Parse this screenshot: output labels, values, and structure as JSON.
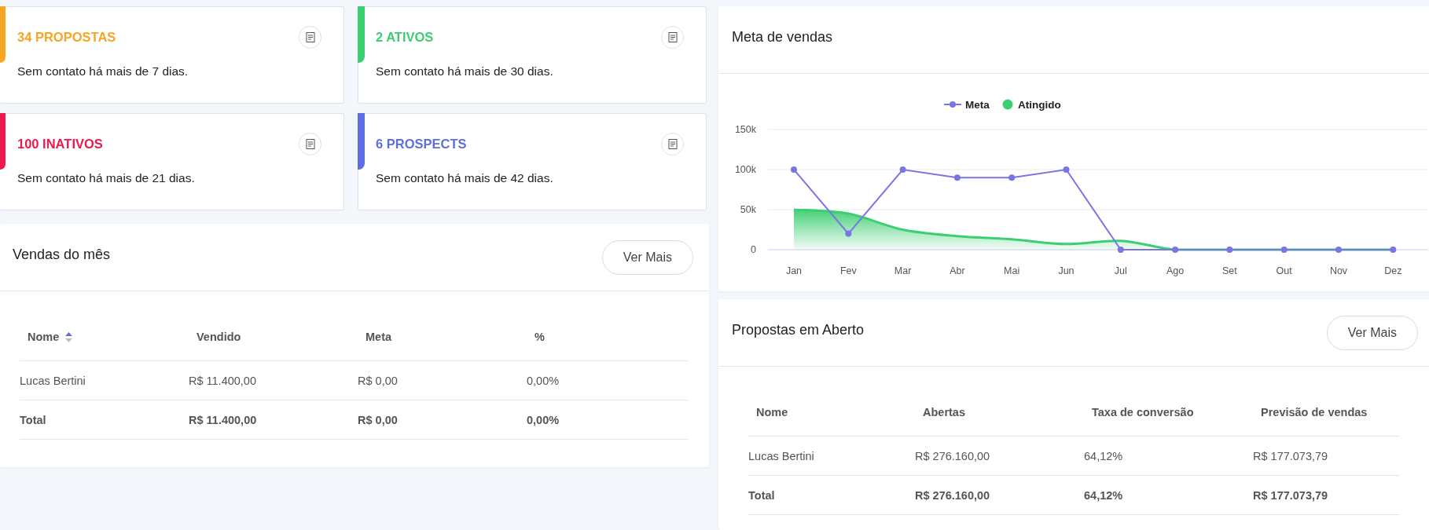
{
  "alert_cards": [
    {
      "title": "34 PROPOSTAS",
      "text": "Sem contato há mais de 7 dias.",
      "color": "#f6a623"
    },
    {
      "title": "2 ATIVOS",
      "text": "Sem contato há mais de 30 dias.",
      "color": "#3ccf72"
    },
    {
      "title": "100 INATIVOS",
      "text": "Sem contato há mais de 21 dias.",
      "color": "#ee1a4e"
    },
    {
      "title": "6 PROSPECTS",
      "text": "Sem contato há mais de 42 dias.",
      "color": "#5d6fe0"
    }
  ],
  "sales_month": {
    "title": "Vendas do mês",
    "button": "Ver Mais",
    "columns": [
      {
        "label": "Nome",
        "kind": "sortable"
      },
      {
        "label": "Vendido",
        "kind": "plain"
      },
      {
        "label": "Meta",
        "kind": "plain"
      },
      {
        "label": "%",
        "kind": "plain"
      }
    ],
    "rows": [
      {
        "kind": "item",
        "cells": [
          "Lucas Bertini",
          "R$ 11.400,00",
          "R$ 0,00",
          "0,00%"
        ]
      },
      {
        "kind": "total",
        "cells": [
          "Total",
          "R$ 11.400,00",
          "R$ 0,00",
          "0,00%"
        ]
      }
    ]
  },
  "sales_goal": {
    "title": "Meta de vendas",
    "chart_data": {
      "type": "line",
      "categories": [
        "Jan",
        "Fev",
        "Mar",
        "Abr",
        "Mai",
        "Jun",
        "Jul",
        "Ago",
        "Set",
        "Out",
        "Nov",
        "Dez"
      ],
      "series": [
        {
          "name": "Meta",
          "color": "#7b75e3",
          "marker": true,
          "values": [
            100000,
            20000,
            100000,
            90000,
            90000,
            100000,
            0,
            0,
            0,
            0,
            0,
            0
          ]
        },
        {
          "name": "Atingido",
          "color": "#3ccf72",
          "marker": false,
          "values": [
            50000,
            45000,
            25000,
            17000,
            13000,
            7000,
            11000,
            0,
            0,
            0,
            0,
            0
          ]
        }
      ],
      "ylim": [
        0,
        150000
      ],
      "legend": true,
      "yticks": [
        {
          "value": 0,
          "label": "0"
        },
        {
          "value": 50000,
          "label": "50k"
        },
        {
          "value": 100000,
          "label": "100k"
        },
        {
          "value": 150000,
          "label": "150k"
        }
      ]
    }
  },
  "open_proposals": {
    "title": "Propostas em Aberto",
    "button": "Ver Mais",
    "columns": [
      {
        "label": "Nome"
      },
      {
        "label": "Abertas"
      },
      {
        "label": "Taxa de conversão"
      },
      {
        "label": "Previsão de vendas"
      }
    ],
    "rows": [
      {
        "kind": "item",
        "cells": [
          "Lucas Bertini",
          "R$ 276.160,00",
          "64,12%",
          "R$ 177.073,79"
        ]
      },
      {
        "kind": "total",
        "cells": [
          "Total",
          "R$ 276.160,00",
          "64,12%",
          "R$ 177.073,79"
        ]
      }
    ]
  }
}
